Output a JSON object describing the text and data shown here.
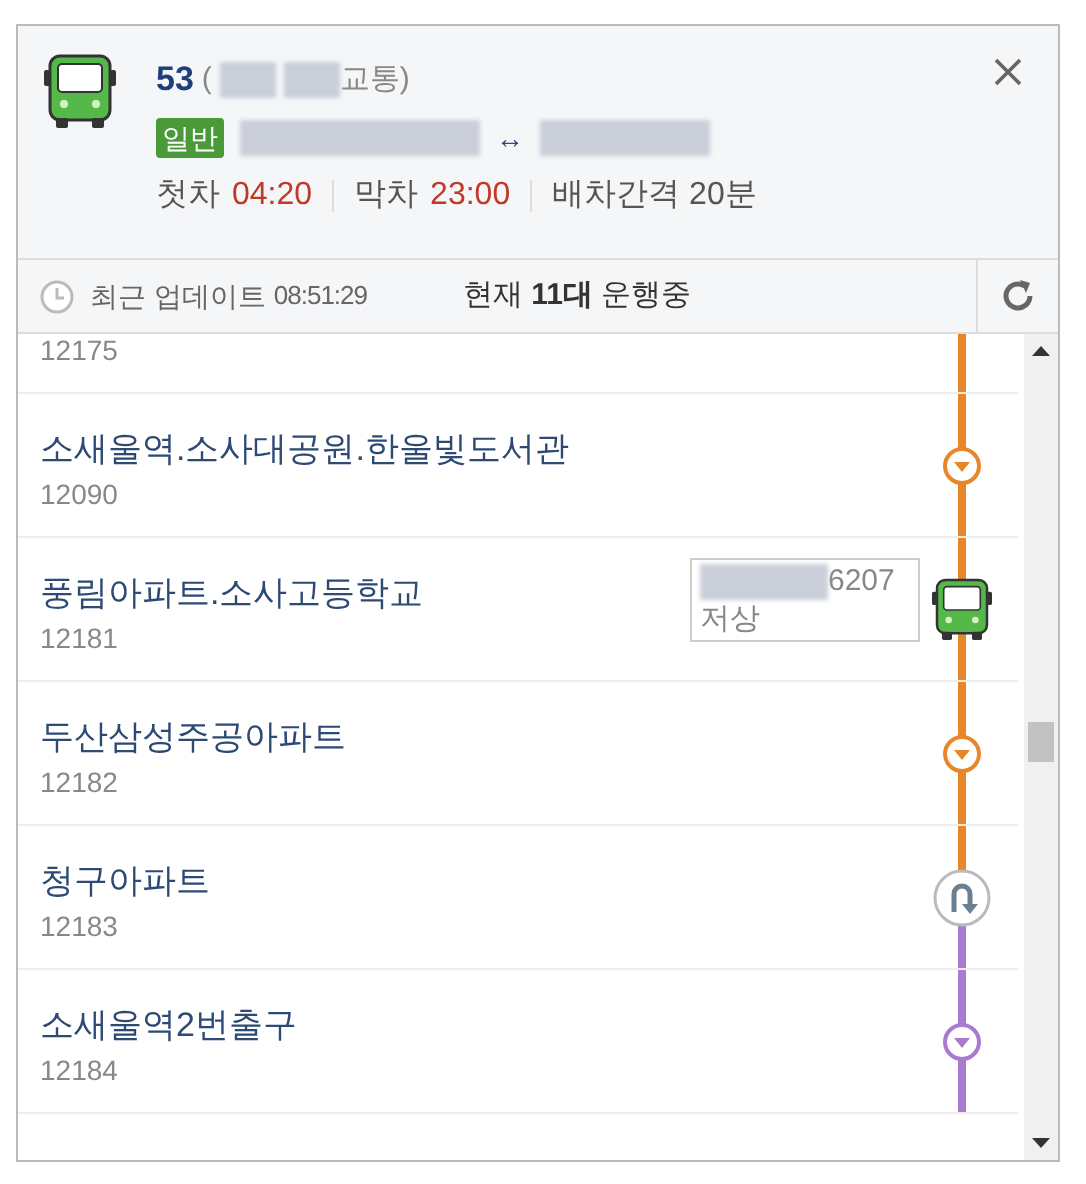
{
  "route": {
    "number": "53",
    "open_paren": "(",
    "operator_tail": "교통)",
    "type_tag": "일반",
    "direction_arrow": "↔"
  },
  "schedule": [
    {
      "label": "첫차",
      "value": "04:20"
    },
    {
      "label": "막차",
      "value": "23:00"
    },
    {
      "label": "배차간격 20분"
    }
  ],
  "update_bar": {
    "label": "최근 업데이트",
    "time": "08:51:29",
    "running": "현재 **11대** 운행중"
  },
  "stops": [
    {
      "id": "12175",
      "kind": "none",
      "color": "#e8862a"
    },
    {
      "name": "소새울역.소사대공원.한울빛도서관",
      "id": "12090",
      "kind": "down",
      "color": "#e8862a"
    },
    {
      "name": "풍림아파트.소사고등학교",
      "id": "12181",
      "kind": "bus",
      "color": "#e8862a",
      "bus": {
        "plate_tail": "6207",
        "type": "저상"
      }
    },
    {
      "name": "두산삼성주공아파트",
      "id": "12182",
      "kind": "down",
      "color": "#e8862a"
    },
    {
      "name": "청구아파트",
      "id": "12183",
      "kind": "turn",
      "color": "#a87ad0"
    },
    {
      "name": "소새울역2번출구",
      "id": "12184",
      "kind": "down",
      "color": "#a87ad0"
    }
  ]
}
